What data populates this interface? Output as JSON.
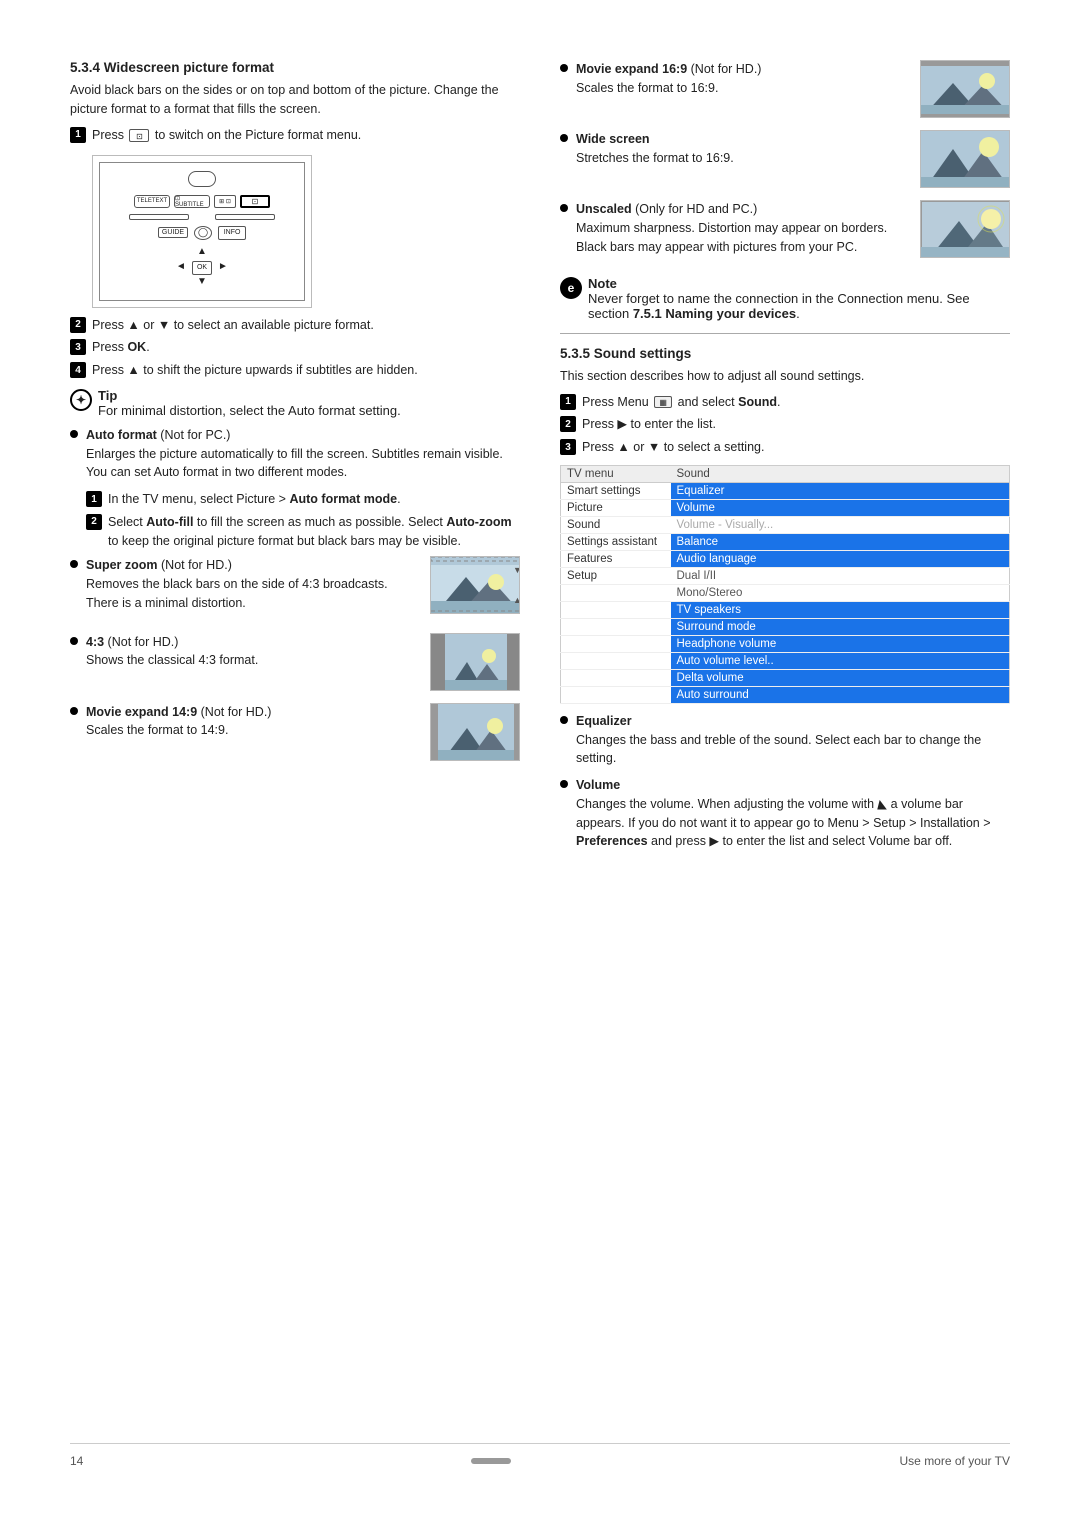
{
  "page": {
    "number": "14",
    "footer_right": "Use more of your TV"
  },
  "section_left": {
    "title": "5.3.4  Widescreen picture format",
    "intro": "Avoid black bars on the sides or on top and bottom of the picture. Change the picture format to a format that fills the screen.",
    "step1": "Press",
    "step1_suffix": " to switch on the Picture format menu.",
    "step2": "Press ▲ or ▼ to select an available picture format.",
    "step3": "Press OK.",
    "step4": "Press ▲ to shift the picture upwards if subtitles are hidden.",
    "tip_header": "Tip",
    "tip_text": "For minimal distortion, select the Auto format setting.",
    "bullet_auto_title": "Auto format",
    "bullet_auto_suffix": " (Not for PC.)",
    "bullet_auto_desc": "Enlarges the picture automatically to fill the screen. Subtitles remain visible. You can set Auto format in two different modes.",
    "step_auto1": "In the TV menu, select Picture > ",
    "step_auto1_bold": "Auto format mode",
    "step_auto1_suffix": ".",
    "step_auto2_part1": "Select ",
    "step_auto2_bold1": "Auto-fill",
    "step_auto2_part2": " to fill the screen as much as possible. Select ",
    "step_auto2_bold2": "Auto-zoom",
    "step_auto2_part3": " to keep the original picture format but black bars may be visible.",
    "bullet_superzoom_title": "Super zoom",
    "bullet_superzoom_suffix": " (Not for HD.)",
    "bullet_superzoom_desc": "Removes the black bars on the side of 4:3 broadcasts. There is a minimal distortion.",
    "bullet_43_title": "4:3",
    "bullet_43_suffix": " (Not for HD.)",
    "bullet_43_desc": "Shows the classical 4:3 format.",
    "bullet_movie149_title": "Movie expand 14:9",
    "bullet_movie149_suffix": " (Not for HD.)",
    "bullet_movie149_desc": "Scales the format to 14:9."
  },
  "section_right": {
    "bullet_movie169_title": "Movie expand 16:9",
    "bullet_movie169_suffix": " (Not for HD.)",
    "bullet_movie169_desc": "Scales the format to 16:9.",
    "bullet_widescreen_title": "Wide screen",
    "bullet_widescreen_desc": "Stretches the format to 16:9.",
    "bullet_unscaled_title": "Unscaled",
    "bullet_unscaled_suffix": " (Only for HD and PC.)",
    "bullet_unscaled_desc": "Maximum sharpness. Distortion may appear on borders. Black bars may appear with pictures from your PC.",
    "note_header": "Note",
    "note_text": "Never forget to name the connection in the Connection menu. See section 7.5.1 Naming your devices.",
    "divider": true,
    "section2_title": "5.3.5  Sound settings",
    "section2_intro": "This section describes how to adjust all sound settings.",
    "step1": "Press Menu",
    "step1_suffix": " and select ",
    "step1_bold": "Sound",
    "step1_end": ".",
    "step2": "Press ▶ to enter the list.",
    "step3": "Press ▲ or ▼ to select a setting.",
    "menu_header_left": "TV menu",
    "menu_header_right": "Sound",
    "menu_rows": [
      {
        "left": "Smart settings",
        "right": "Equalizer",
        "highlight": true
      },
      {
        "left": "Picture",
        "right": "Volume",
        "highlight": true
      },
      {
        "left": "Sound",
        "right": "Volume - Visually...",
        "highlight": false,
        "dim": true
      },
      {
        "left": "Settings assistant",
        "right": "Balance",
        "highlight": true
      },
      {
        "left": "Features",
        "right": "Audio language",
        "highlight": true
      },
      {
        "left": "Setup",
        "right": "Dual I/II",
        "highlight": false
      },
      {
        "left": "",
        "right": "Mono/Stereo",
        "highlight": false
      },
      {
        "left": "",
        "right": "TV speakers",
        "highlight": true
      },
      {
        "left": "",
        "right": "Surround mode",
        "highlight": true
      },
      {
        "left": "",
        "right": "Headphone volume",
        "highlight": true
      },
      {
        "left": "",
        "right": "Auto volume level..",
        "highlight": true
      },
      {
        "left": "",
        "right": "Delta volume",
        "highlight": true
      },
      {
        "left": "",
        "right": "Auto surround",
        "highlight": true
      }
    ],
    "bullet_eq_title": "Equalizer",
    "bullet_eq_desc": "Changes the bass and treble of the sound. Select each bar to change the setting.",
    "bullet_vol_title": "Volume",
    "bullet_vol_desc1": "Changes the volume. When adjusting the volume with",
    "bullet_vol_desc2": " a volume bar appears. If you do not want it to appear go to Menu > Setup > Installation > ",
    "bullet_vol_bold": "Preferences",
    "bullet_vol_desc3": " and press ▶ to enter the list and select Volume bar off."
  }
}
